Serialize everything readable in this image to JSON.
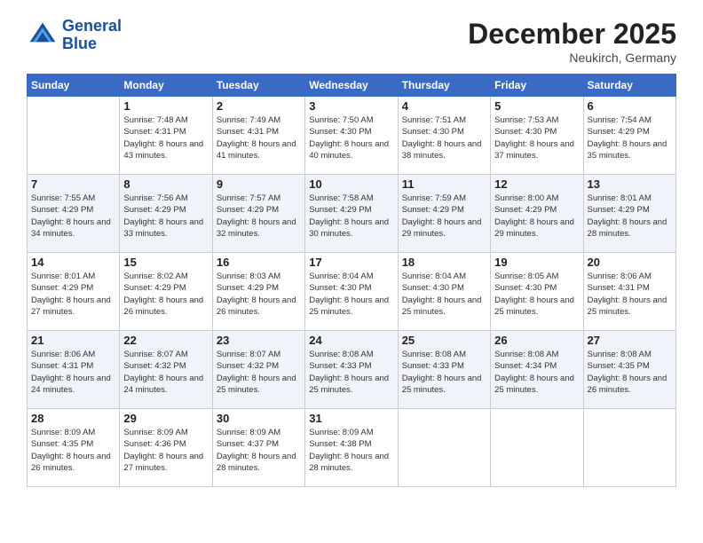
{
  "header": {
    "logo_line1": "General",
    "logo_line2": "Blue",
    "month": "December 2025",
    "location": "Neukirch, Germany"
  },
  "days_of_week": [
    "Sunday",
    "Monday",
    "Tuesday",
    "Wednesday",
    "Thursday",
    "Friday",
    "Saturday"
  ],
  "weeks": [
    [
      {
        "day": null
      },
      {
        "day": "1",
        "sunrise": "7:48 AM",
        "sunset": "4:31 PM",
        "daylight": "8 hours and 43 minutes."
      },
      {
        "day": "2",
        "sunrise": "7:49 AM",
        "sunset": "4:31 PM",
        "daylight": "8 hours and 41 minutes."
      },
      {
        "day": "3",
        "sunrise": "7:50 AM",
        "sunset": "4:30 PM",
        "daylight": "8 hours and 40 minutes."
      },
      {
        "day": "4",
        "sunrise": "7:51 AM",
        "sunset": "4:30 PM",
        "daylight": "8 hours and 38 minutes."
      },
      {
        "day": "5",
        "sunrise": "7:53 AM",
        "sunset": "4:30 PM",
        "daylight": "8 hours and 37 minutes."
      },
      {
        "day": "6",
        "sunrise": "7:54 AM",
        "sunset": "4:29 PM",
        "daylight": "8 hours and 35 minutes."
      }
    ],
    [
      {
        "day": "7",
        "sunrise": "7:55 AM",
        "sunset": "4:29 PM",
        "daylight": "8 hours and 34 minutes."
      },
      {
        "day": "8",
        "sunrise": "7:56 AM",
        "sunset": "4:29 PM",
        "daylight": "8 hours and 33 minutes."
      },
      {
        "day": "9",
        "sunrise": "7:57 AM",
        "sunset": "4:29 PM",
        "daylight": "8 hours and 32 minutes."
      },
      {
        "day": "10",
        "sunrise": "7:58 AM",
        "sunset": "4:29 PM",
        "daylight": "8 hours and 30 minutes."
      },
      {
        "day": "11",
        "sunrise": "7:59 AM",
        "sunset": "4:29 PM",
        "daylight": "8 hours and 29 minutes."
      },
      {
        "day": "12",
        "sunrise": "8:00 AM",
        "sunset": "4:29 PM",
        "daylight": "8 hours and 29 minutes."
      },
      {
        "day": "13",
        "sunrise": "8:01 AM",
        "sunset": "4:29 PM",
        "daylight": "8 hours and 28 minutes."
      }
    ],
    [
      {
        "day": "14",
        "sunrise": "8:01 AM",
        "sunset": "4:29 PM",
        "daylight": "8 hours and 27 minutes."
      },
      {
        "day": "15",
        "sunrise": "8:02 AM",
        "sunset": "4:29 PM",
        "daylight": "8 hours and 26 minutes."
      },
      {
        "day": "16",
        "sunrise": "8:03 AM",
        "sunset": "4:29 PM",
        "daylight": "8 hours and 26 minutes."
      },
      {
        "day": "17",
        "sunrise": "8:04 AM",
        "sunset": "4:30 PM",
        "daylight": "8 hours and 25 minutes."
      },
      {
        "day": "18",
        "sunrise": "8:04 AM",
        "sunset": "4:30 PM",
        "daylight": "8 hours and 25 minutes."
      },
      {
        "day": "19",
        "sunrise": "8:05 AM",
        "sunset": "4:30 PM",
        "daylight": "8 hours and 25 minutes."
      },
      {
        "day": "20",
        "sunrise": "8:06 AM",
        "sunset": "4:31 PM",
        "daylight": "8 hours and 25 minutes."
      }
    ],
    [
      {
        "day": "21",
        "sunrise": "8:06 AM",
        "sunset": "4:31 PM",
        "daylight": "8 hours and 24 minutes."
      },
      {
        "day": "22",
        "sunrise": "8:07 AM",
        "sunset": "4:32 PM",
        "daylight": "8 hours and 24 minutes."
      },
      {
        "day": "23",
        "sunrise": "8:07 AM",
        "sunset": "4:32 PM",
        "daylight": "8 hours and 25 minutes."
      },
      {
        "day": "24",
        "sunrise": "8:08 AM",
        "sunset": "4:33 PM",
        "daylight": "8 hours and 25 minutes."
      },
      {
        "day": "25",
        "sunrise": "8:08 AM",
        "sunset": "4:33 PM",
        "daylight": "8 hours and 25 minutes."
      },
      {
        "day": "26",
        "sunrise": "8:08 AM",
        "sunset": "4:34 PM",
        "daylight": "8 hours and 25 minutes."
      },
      {
        "day": "27",
        "sunrise": "8:08 AM",
        "sunset": "4:35 PM",
        "daylight": "8 hours and 26 minutes."
      }
    ],
    [
      {
        "day": "28",
        "sunrise": "8:09 AM",
        "sunset": "4:35 PM",
        "daylight": "8 hours and 26 minutes."
      },
      {
        "day": "29",
        "sunrise": "8:09 AM",
        "sunset": "4:36 PM",
        "daylight": "8 hours and 27 minutes."
      },
      {
        "day": "30",
        "sunrise": "8:09 AM",
        "sunset": "4:37 PM",
        "daylight": "8 hours and 28 minutes."
      },
      {
        "day": "31",
        "sunrise": "8:09 AM",
        "sunset": "4:38 PM",
        "daylight": "8 hours and 28 minutes."
      },
      {
        "day": null
      },
      {
        "day": null
      },
      {
        "day": null
      }
    ]
  ]
}
